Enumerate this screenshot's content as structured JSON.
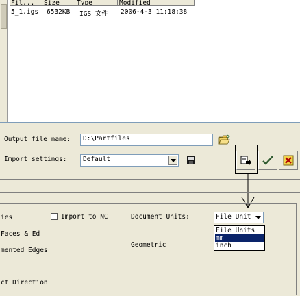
{
  "file_list": {
    "columns": [
      "Fil...",
      "Size",
      "Type",
      "Modified"
    ],
    "rows": [
      {
        "name": "5_1.igs",
        "size": "6532KB",
        "type": "IGS 文件",
        "modified": "2006-4-3 11:18:38"
      }
    ]
  },
  "output": {
    "label": "Output file name:",
    "value": "D:\\Partfiles"
  },
  "import_settings": {
    "label": "Import settings:",
    "value": "Default"
  },
  "options": {
    "partial_labels": [
      "ies",
      "Faces & Ed",
      "mented Edges",
      "ct Direction"
    ],
    "import_to_nc": "Import to NC",
    "document_units_label": "Document Units:",
    "geometric_label": "Geometric",
    "units_selected": "File Unit",
    "units_options": [
      "File Units",
      "mm",
      "inch"
    ]
  }
}
